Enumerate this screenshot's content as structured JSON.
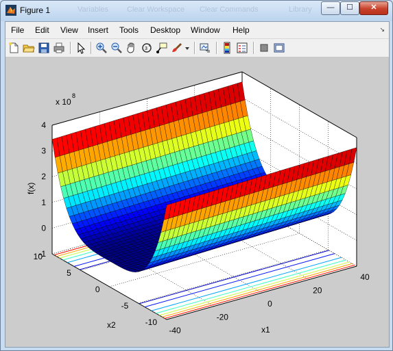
{
  "window": {
    "title": "Figure 1",
    "background_tabs": [
      "Variables",
      "Clear Workspace",
      "Clear Commands",
      "Library"
    ],
    "controls": {
      "minimize": "—",
      "maximize": "☐",
      "close": "✕"
    }
  },
  "menu": {
    "items": [
      "File",
      "Edit",
      "View",
      "Insert",
      "Tools",
      "Desktop",
      "Window",
      "Help"
    ],
    "dock_arrow": "↘"
  },
  "toolbar": {
    "buttons": [
      "new-figure-icon",
      "open-file-icon",
      "save-icon",
      "print-icon",
      "edit-plot-arrow-icon",
      "zoom-in-icon",
      "zoom-out-icon",
      "pan-hand-icon",
      "rotate-3d-icon",
      "data-cursor-icon",
      "brush-icon",
      "brush-dropdown-icon",
      "link-plot-icon",
      "insert-colorbar-icon",
      "insert-legend-icon",
      "hide-plot-tools-icon",
      "show-plot-tools-icon"
    ]
  },
  "plot": {
    "exponent_label": "x 10",
    "exponent_power": "8",
    "zlabel": "f(x)",
    "xlabel": "x1",
    "ylabel": "x2"
  },
  "chart_data": {
    "type": "surface",
    "title": "",
    "xlabel": "x1",
    "ylabel": "x2",
    "zlabel": "f(x)",
    "xticks": [
      "-40",
      "-20",
      "0",
      "20",
      "40"
    ],
    "yticks": [
      "-10",
      "-5",
      "0",
      "5",
      "10"
    ],
    "zticks": [
      "-1",
      "0",
      "1",
      "2",
      "3",
      "4"
    ],
    "z_multiplier": "x 10^8",
    "xlim": [
      -40,
      40
    ],
    "ylim": [
      -10,
      10
    ],
    "zlim": [
      -100000000,
      400000000
    ],
    "grid": true,
    "colormap": "jet",
    "contours_on_floor": true,
    "surface": "trough shaped in x2, nearly flat along x1; min ≈ 0 at x2 = 0, max ≈ 3.5e8 at x2 = ±10"
  },
  "colors": {
    "axes_background": "#ffffff",
    "figure_background": "#cccccc",
    "mesh_line": "#000000"
  }
}
